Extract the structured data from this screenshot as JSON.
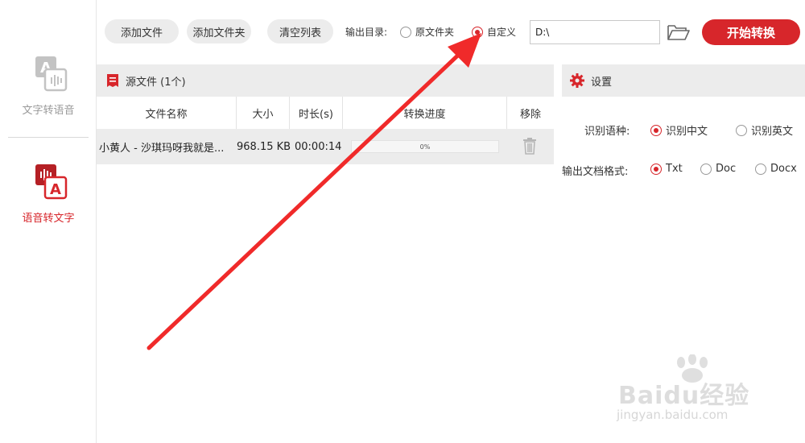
{
  "sidebar": {
    "items": [
      {
        "label": "文字转语音",
        "icon": "text-to-speech-icon",
        "active": false
      },
      {
        "label": "语音转文字",
        "icon": "speech-to-text-icon",
        "active": true
      }
    ]
  },
  "toolbar": {
    "add_file": "添加文件",
    "add_folder": "添加文件夹",
    "clear_list": "清空列表",
    "output_dir_label": "输出目录:",
    "output_options": [
      {
        "label": "原文件夹",
        "selected": false
      },
      {
        "label": "自定义",
        "selected": true
      }
    ],
    "output_path": "D:\\",
    "start_label": "开始转换"
  },
  "files": {
    "header": "源文件 (1个)",
    "columns": [
      "文件名称",
      "大小",
      "时长(s)",
      "转换进度",
      "移除"
    ],
    "rows": [
      {
        "name": "小黄人 - 沙琪玛呀我就是...",
        "size": "968.15 KB",
        "duration": "00:00:14",
        "progress_text": "0%",
        "progress": 0
      }
    ]
  },
  "settings": {
    "header": "设置",
    "language_label": "识别语种:",
    "language_options": [
      {
        "label": "识别中文",
        "selected": true
      },
      {
        "label": "识别英文",
        "selected": false
      }
    ],
    "format_label": "输出文档格式:",
    "format_options": [
      {
        "label": "Txt",
        "selected": true
      },
      {
        "label": "Doc",
        "selected": false
      },
      {
        "label": "Docx",
        "selected": false
      }
    ]
  },
  "watermark": {
    "brand": "Baidu经验",
    "url": "jingyan.baidu.com"
  },
  "colors": {
    "accent": "#d7262b",
    "panel_bg": "#ececec",
    "inactive_icon": "#bdbdbd"
  }
}
